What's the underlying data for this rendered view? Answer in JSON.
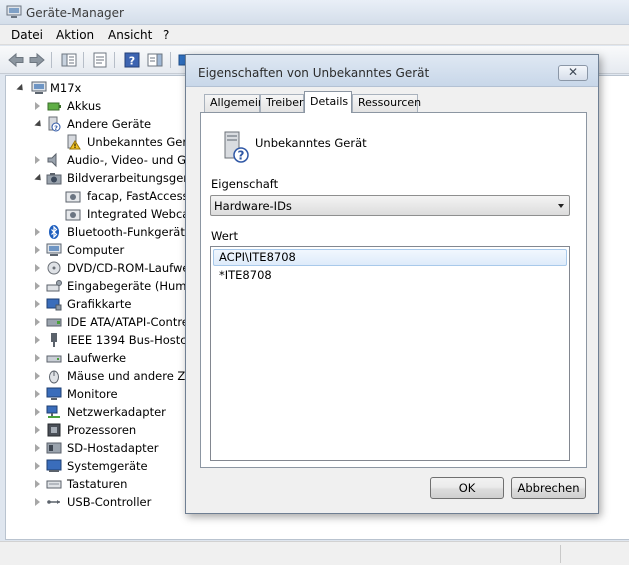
{
  "window": {
    "title": "Geräte-Manager"
  },
  "menu": [
    "Datei",
    "Aktion",
    "Ansicht",
    "?"
  ],
  "tree": {
    "root": "M17x",
    "items": [
      {
        "label": "Akkus",
        "icon": "battery-icon",
        "level": 1,
        "expanded": false
      },
      {
        "label": "Andere Geräte",
        "icon": "unknown-device-icon",
        "level": 1,
        "expanded": true
      },
      {
        "label": "Unbekanntes Gerät",
        "icon": "warning-device-icon",
        "level": 2
      },
      {
        "label": "Audio-, Video- und Ga",
        "icon": "speaker-icon",
        "level": 1,
        "expanded": false
      },
      {
        "label": "Bildverarbeitungsgerät",
        "icon": "camera-icon",
        "level": 1,
        "expanded": true
      },
      {
        "label": "facap, FastAccess V",
        "icon": "webcam-icon",
        "level": 2
      },
      {
        "label": "Integrated Webcam",
        "icon": "webcam-icon",
        "level": 2
      },
      {
        "label": "Bluetooth-Funkgerät",
        "icon": "bluetooth-icon",
        "level": 1,
        "expanded": false
      },
      {
        "label": "Computer",
        "icon": "computer-icon",
        "level": 1,
        "expanded": false
      },
      {
        "label": "DVD/CD-ROM-Laufwe",
        "icon": "dvd-drive-icon",
        "level": 1,
        "expanded": false
      },
      {
        "label": "Eingabegeräte (Humar",
        "icon": "input-device-icon",
        "level": 1,
        "expanded": false
      },
      {
        "label": "Grafikkarte",
        "icon": "display-adapter-icon",
        "level": 1,
        "expanded": false
      },
      {
        "label": "IDE ATA/ATAPI-Contre",
        "icon": "ide-controller-icon",
        "level": 1,
        "expanded": false
      },
      {
        "label": "IEEE 1394 Bus-Hostcor",
        "icon": "firewire-icon",
        "level": 1,
        "expanded": false
      },
      {
        "label": "Laufwerke",
        "icon": "disk-drive-icon",
        "level": 1,
        "expanded": false
      },
      {
        "label": "Mäuse und andere Zei",
        "icon": "mouse-icon",
        "level": 1,
        "expanded": false
      },
      {
        "label": "Monitore",
        "icon": "monitor-icon",
        "level": 1,
        "expanded": false
      },
      {
        "label": "Netzwerkadapter",
        "icon": "network-adapter-icon",
        "level": 1,
        "expanded": false
      },
      {
        "label": "Prozessoren",
        "icon": "processor-icon",
        "level": 1,
        "expanded": false
      },
      {
        "label": "SD-Hostadapter",
        "icon": "sd-host-icon",
        "level": 1,
        "expanded": false
      },
      {
        "label": "Systemgeräte",
        "icon": "system-device-icon",
        "level": 1,
        "expanded": false
      },
      {
        "label": "Tastaturen",
        "icon": "keyboard-icon",
        "level": 1,
        "expanded": false
      },
      {
        "label": "USB-Controller",
        "icon": "usb-icon",
        "level": 1,
        "expanded": false
      }
    ]
  },
  "dialog": {
    "title": "Eigenschaften von Unbekanntes Gerät",
    "close_label": "✕",
    "tabs": [
      "Allgemein",
      "Treiber",
      "Details",
      "Ressourcen"
    ],
    "active_tab": "Details",
    "device_name": "Unbekanntes Gerät",
    "property_label": "Eigenschaft",
    "property_value": "Hardware-IDs",
    "value_label": "Wert",
    "values": [
      "ACPI\\ITE8708",
      "*ITE8708"
    ],
    "ok_label": "OK",
    "cancel_label": "Abbrechen"
  }
}
